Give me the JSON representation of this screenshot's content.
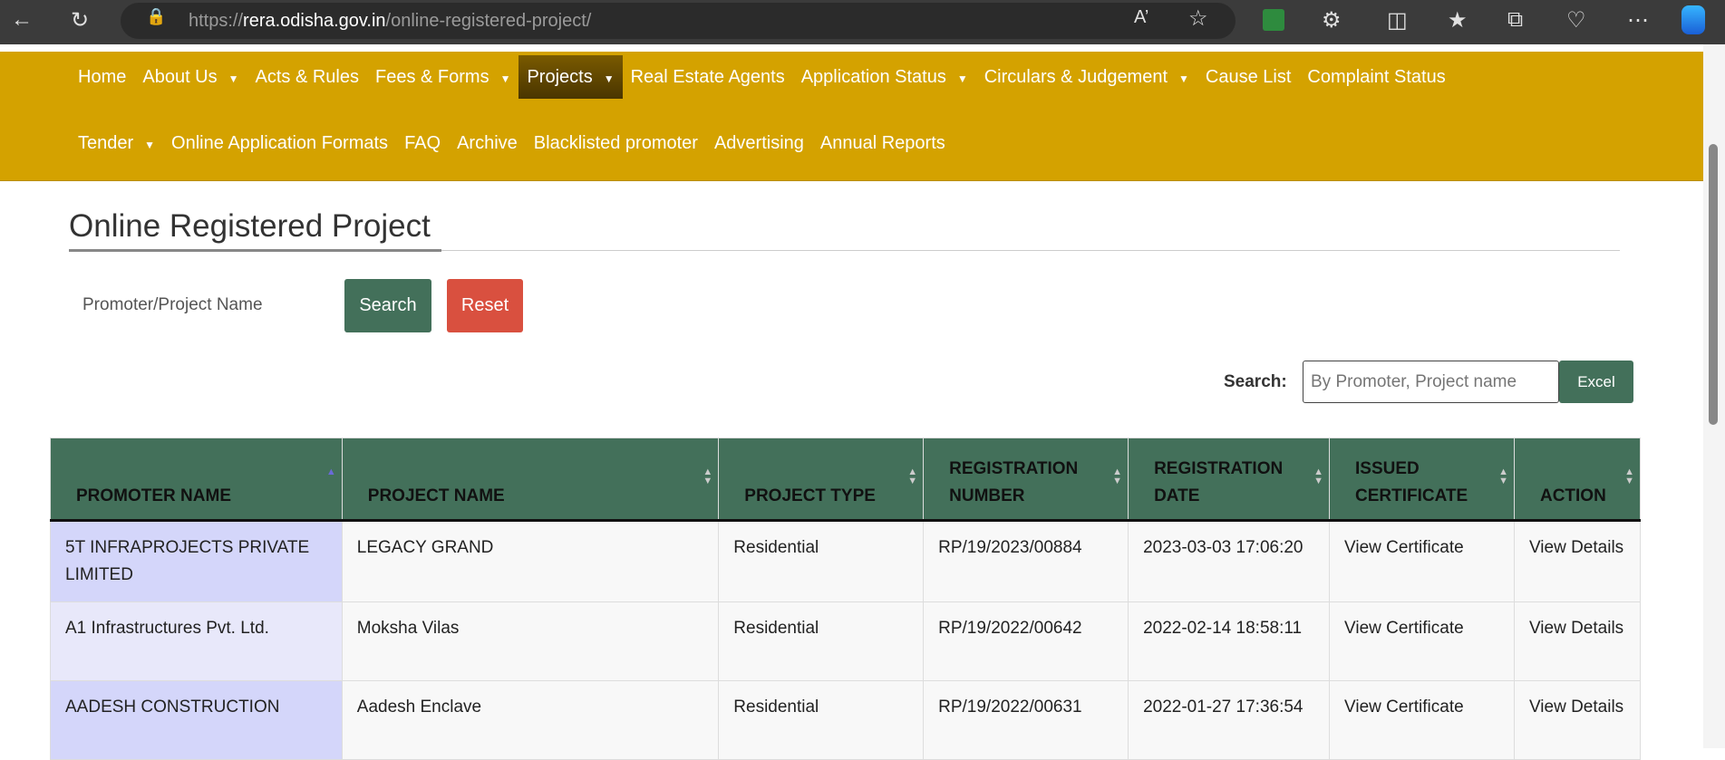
{
  "browser": {
    "url_prefix": "https://",
    "url_domain": "rera.odisha.gov.in",
    "url_path": "/online-registered-project/"
  },
  "nav": {
    "row1": [
      {
        "label": "Home"
      },
      {
        "label": "About Us",
        "caret": true
      },
      {
        "label": "Acts & Rules"
      },
      {
        "label": "Fees & Forms",
        "caret": true
      },
      {
        "label": "Projects",
        "caret": true,
        "active": true
      },
      {
        "label": "Real Estate Agents"
      },
      {
        "label": "Application Status",
        "caret": true
      },
      {
        "label": "Circulars & Judgement",
        "caret": true
      },
      {
        "label": "Cause List"
      },
      {
        "label": "Complaint Status"
      }
    ],
    "row2": [
      {
        "label": "Tender",
        "caret": true
      },
      {
        "label": "Online Application Formats"
      },
      {
        "label": "FAQ"
      },
      {
        "label": "Archive"
      },
      {
        "label": "Blacklisted promoter"
      },
      {
        "label": "Advertising"
      },
      {
        "label": "Annual Reports"
      }
    ]
  },
  "page": {
    "title": "Online Registered Project",
    "filter_label": "Promoter/Project Name",
    "search_btn": "Search",
    "reset_btn": "Reset",
    "search_label": "Search:",
    "search_placeholder": "By Promoter, Project name",
    "excel_btn": "Excel"
  },
  "table": {
    "headers": [
      "PROMOTER NAME",
      "PROJECT NAME",
      "PROJECT TYPE",
      "REGISTRATION NUMBER",
      "REGISTRATION DATE",
      "ISSUED CERTIFICATE",
      "ACTION"
    ],
    "rows": [
      [
        "5T INFRAPROJECTS PRIVATE LIMITED",
        "LEGACY GRAND",
        "Residential",
        "RP/19/2023/00884",
        "2023-03-03 17:06:20",
        "View Certificate",
        "View Details"
      ],
      [
        "A1 Infrastructures Pvt. Ltd.",
        "Moksha Vilas",
        "Residential",
        "RP/19/2022/00642",
        "2022-02-14 18:58:11",
        "View Certificate",
        "View Details"
      ],
      [
        "AADESH CONSTRUCTION",
        "Aadesh Enclave",
        "Residential",
        "RP/19/2022/00631",
        "2022-01-27 17:36:54",
        "View Certificate",
        "View Details"
      ]
    ]
  },
  "colors": {
    "nav": "#d4a200",
    "green": "#43705a",
    "red": "#d9503f"
  }
}
